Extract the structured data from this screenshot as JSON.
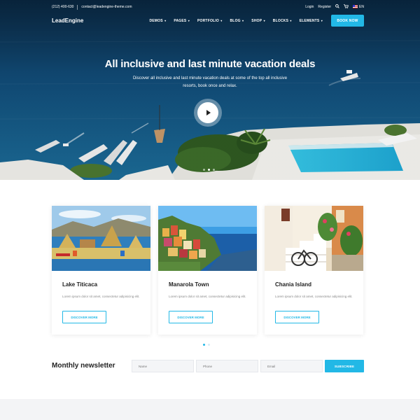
{
  "topbar": {
    "phone": "(212) 400-630",
    "email": "contact@leadengine-theme.com",
    "login": "Login",
    "register": "Register",
    "search_icon": "search-icon",
    "cart_icon": "cart-icon",
    "language": "EN"
  },
  "nav": {
    "logo": "LeadEngine",
    "items": [
      {
        "label": "DEMOS"
      },
      {
        "label": "PAGES"
      },
      {
        "label": "PORTFOLIO"
      },
      {
        "label": "BLOG"
      },
      {
        "label": "SHOP"
      },
      {
        "label": "BLOCKS"
      },
      {
        "label": "ELEMENTS"
      }
    ],
    "book_label": "BOOK NOW"
  },
  "hero": {
    "title": "All inclusive and last minute vacation deals",
    "subtitle": "Discover all inclusive and last minute vacation deals at some of the top all inclusive resorts, book once and relax.",
    "play_icon": "play-icon"
  },
  "cards": [
    {
      "title": "Lake Titicaca",
      "text": "Lorem ipsum dolor sit amet, consectetur adipisicing elit.",
      "button": "DISCOVER MORE"
    },
    {
      "title": "Manarola Town",
      "text": "Lorem ipsum dolor sit amet, consectetur adipisicing elit.",
      "button": "DISCOVER MORE"
    },
    {
      "title": "Chania Island",
      "text": "Lorem ipsum dolor sit amet, consectetur adipisicing elit.",
      "button": "DISCOVER MORE"
    }
  ],
  "newsletter": {
    "title": "Monthly newsletter",
    "name_placeholder": "Name",
    "phone_placeholder": "Phone",
    "email_placeholder": "Email",
    "subscribe_label": "SUBSCRIBE"
  },
  "colors": {
    "accent": "#22b8e6",
    "text_dark": "#222222",
    "text_muted": "#888888"
  }
}
